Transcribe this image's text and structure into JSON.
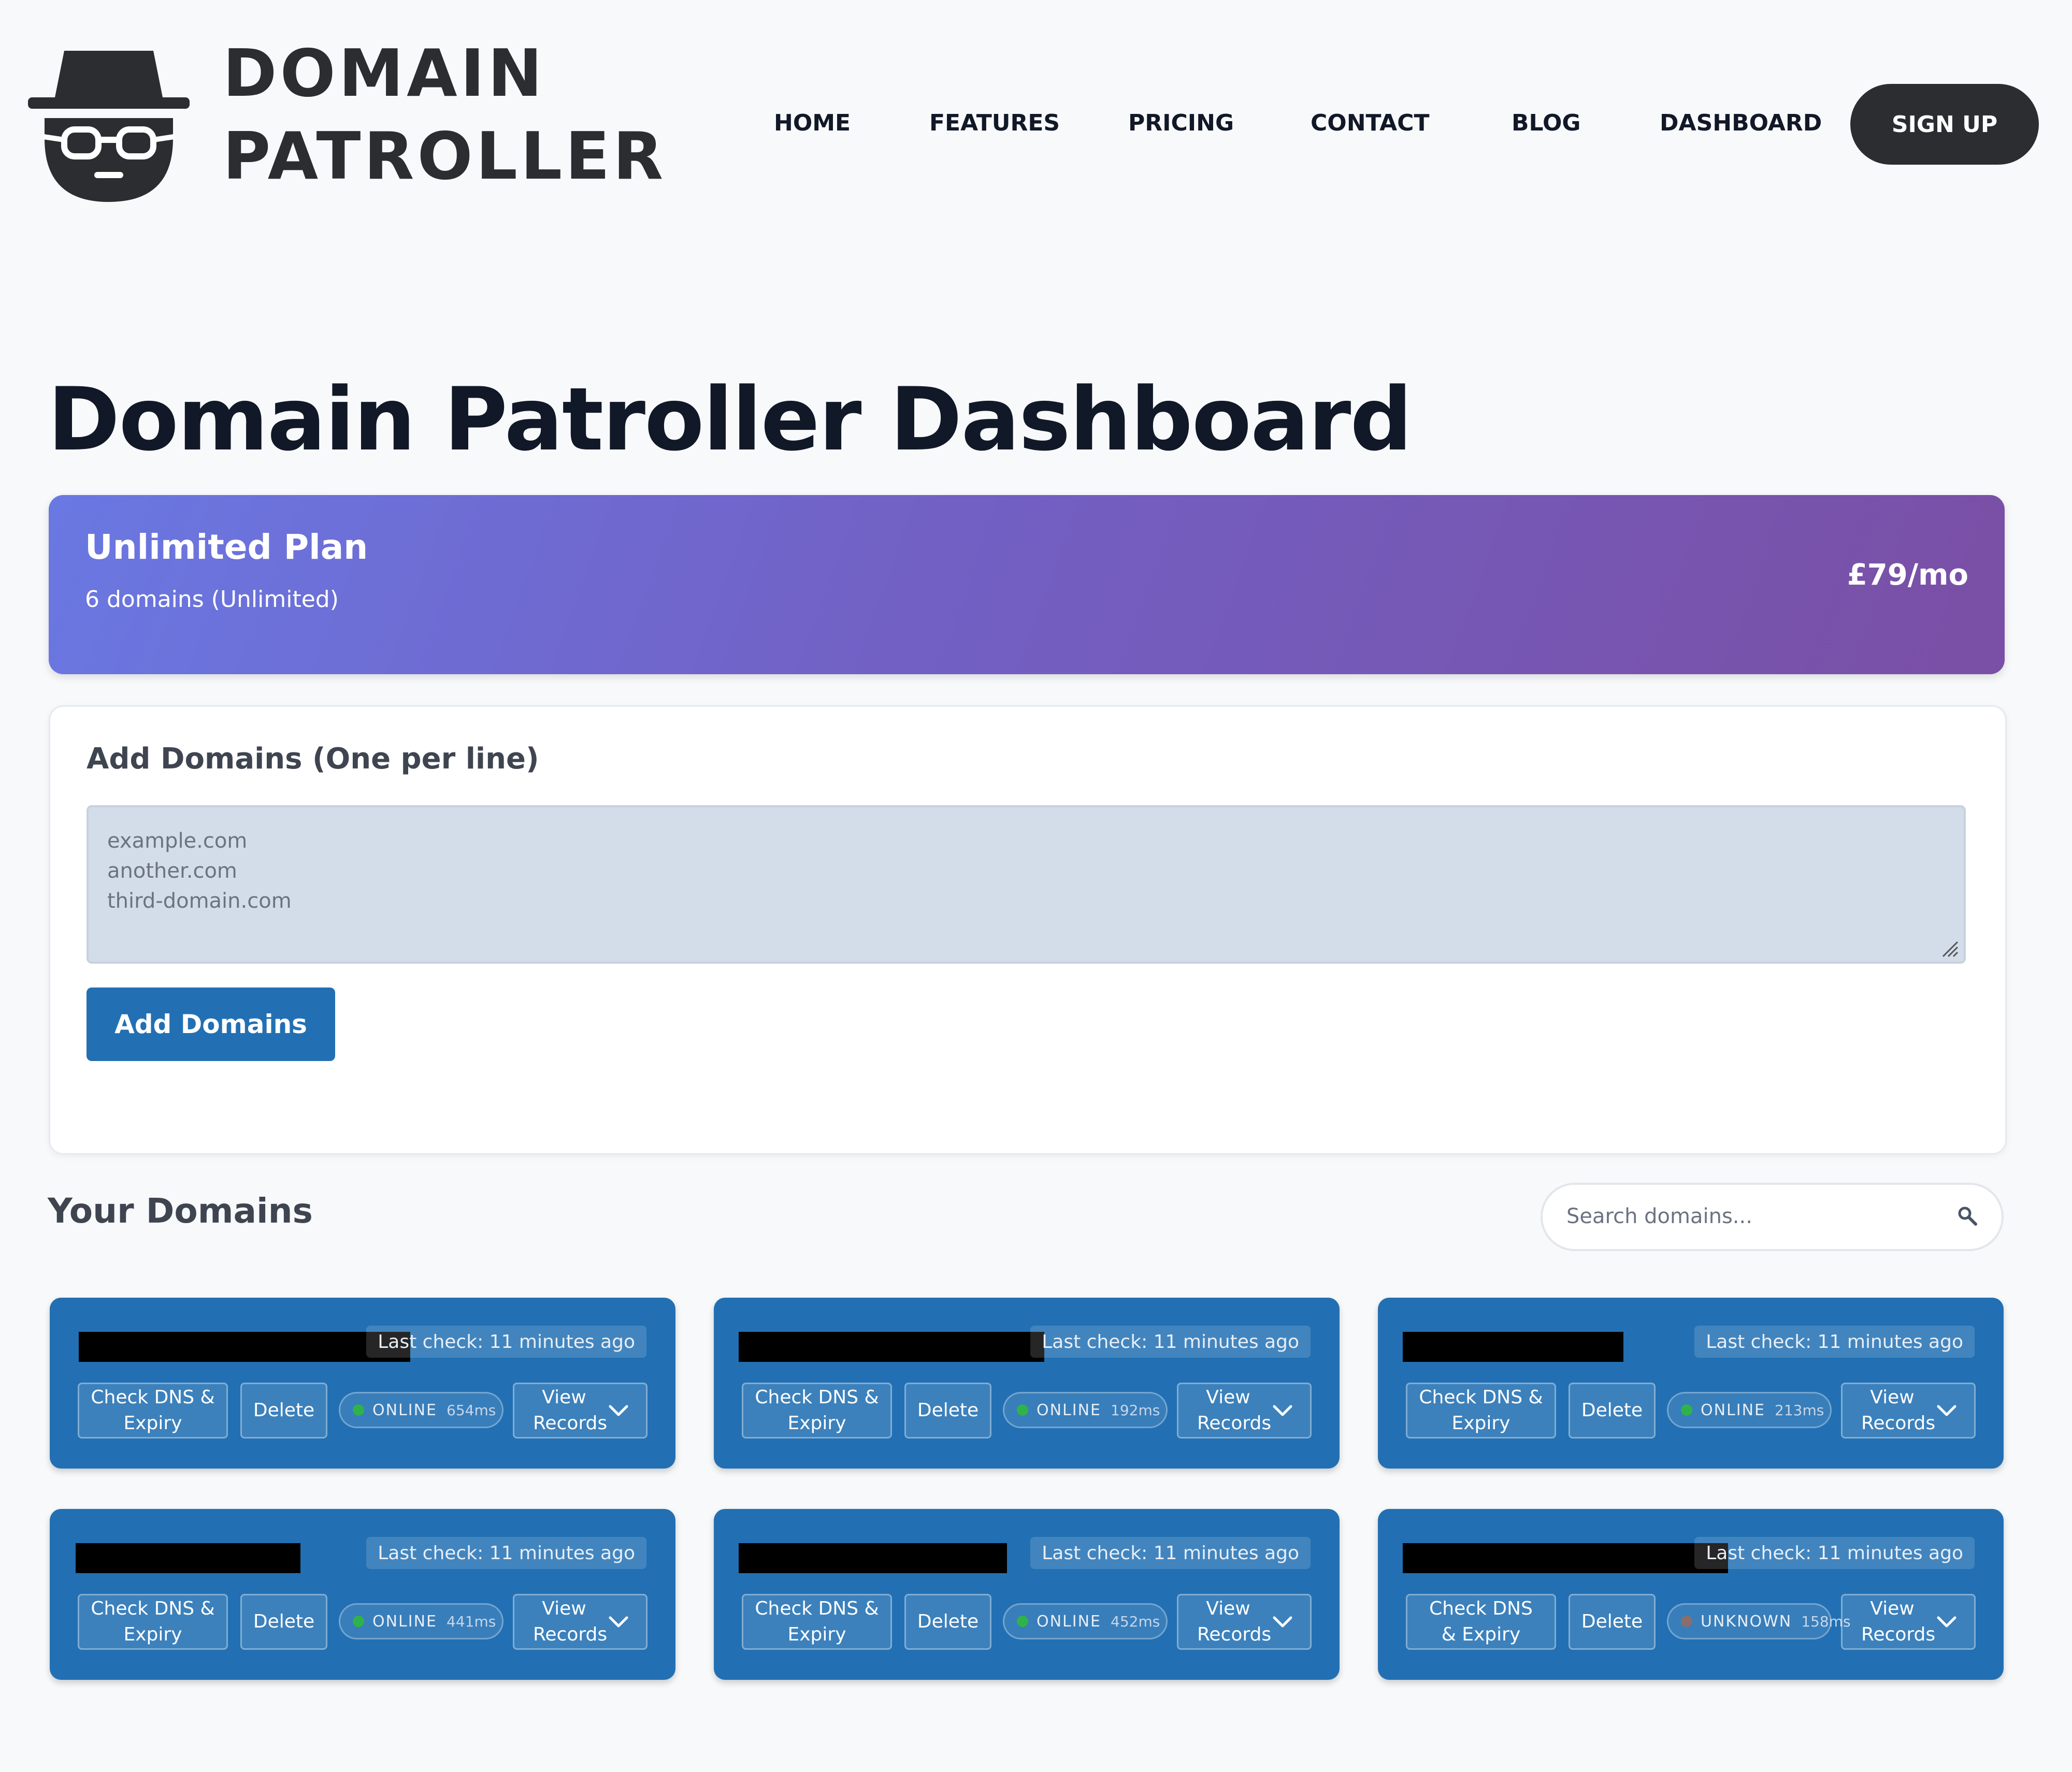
{
  "header": {
    "brand_line1": "DOMAIN",
    "brand_line2": "PATROLLER",
    "logo_icon": "spy-detective-icon",
    "nav": [
      {
        "label": "HOME"
      },
      {
        "label": "FEATURES"
      },
      {
        "label": "PRICING"
      },
      {
        "label": "CONTACT"
      },
      {
        "label": "BLOG"
      },
      {
        "label": "DASHBOARD"
      }
    ],
    "signup_label": "SIGN UP"
  },
  "page": {
    "title": "Domain Patroller Dashboard"
  },
  "plan": {
    "name": "Unlimited Plan",
    "domains_summary": "6 domains (Unlimited)",
    "price": "£79/mo",
    "gradient_start": "#6a78e2",
    "gradient_end": "#7a4fa5"
  },
  "add_domains": {
    "heading": "Add Domains (One per line)",
    "placeholder_lines": [
      "example.com",
      "another.com",
      "third-domain.com"
    ],
    "button_label": "Add Domains"
  },
  "your_domains": {
    "heading": "Your Domains",
    "search_placeholder": "Search domains...",
    "search_icon": "search-icon"
  },
  "accent_color": "#2270b3",
  "domains": [
    {
      "last_check": "Last check: 11 minutes ago",
      "check_label": "Check DNS &\nExpiry",
      "delete_label": "Delete",
      "status": "ONLINE",
      "status_color": "#2fb24a",
      "latency": "654ms",
      "view_label": "View\nRecords"
    },
    {
      "last_check": "Last check: 11 minutes ago",
      "check_label": "Check DNS &\nExpiry",
      "delete_label": "Delete",
      "status": "ONLINE",
      "status_color": "#2fb24a",
      "latency": "192ms",
      "view_label": "View\nRecords"
    },
    {
      "last_check": "Last check: 11 minutes ago",
      "check_label": "Check DNS &\nExpiry",
      "delete_label": "Delete",
      "status": "ONLINE",
      "status_color": "#2fb24a",
      "latency": "213ms",
      "view_label": "View\nRecords"
    },
    {
      "last_check": "Last check: 11 minutes ago",
      "check_label": "Check DNS &\nExpiry",
      "delete_label": "Delete",
      "status": "ONLINE",
      "status_color": "#2fb24a",
      "latency": "441ms",
      "view_label": "View\nRecords"
    },
    {
      "last_check": "Last check: 11 minutes ago",
      "check_label": "Check DNS &\nExpiry",
      "delete_label": "Delete",
      "status": "ONLINE",
      "status_color": "#2fb24a",
      "latency": "452ms",
      "view_label": "View\nRecords"
    },
    {
      "last_check": "Last check: 11 minutes ago",
      "check_label": "Check DNS\n& Expiry",
      "delete_label": "Delete",
      "status": "UNKNOWN",
      "status_color": "#8a6d6d",
      "latency": "158ms",
      "view_label": "View\nRecords"
    }
  ]
}
